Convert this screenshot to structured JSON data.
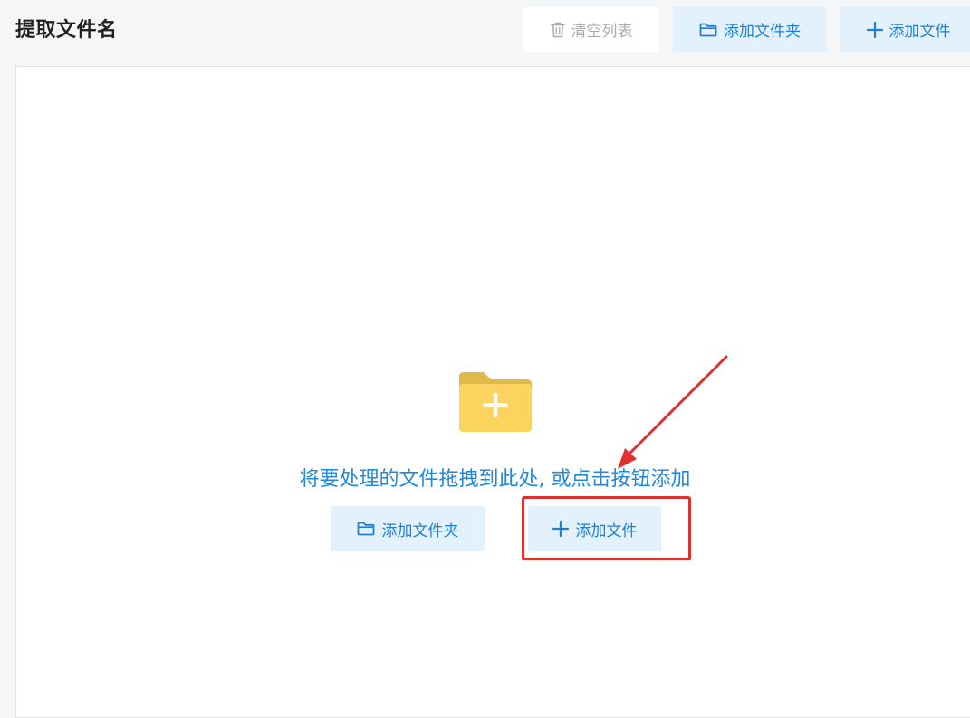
{
  "header": {
    "title": "提取文件名"
  },
  "toolbar": {
    "clear_label": "清空列表",
    "add_folder_label": "添加文件夹",
    "add_file_label": "添加文件"
  },
  "drop_zone": {
    "hint": "将要处理的文件拖拽到此处, 或点击按钮添加",
    "add_folder_label": "添加文件夹",
    "add_file_label": "添加文件"
  },
  "icons": {
    "clear": "trash-icon",
    "folder": "folder-outline-icon",
    "add": "plus-icon",
    "illustration": "folder-add-illustration"
  },
  "colors": {
    "accent": "#1e7fd4",
    "button_bg": "#e3f1fc",
    "disabled_text": "#a9adb2",
    "folder_yellow": "#fad45f",
    "annotation_red": "#e03131"
  }
}
